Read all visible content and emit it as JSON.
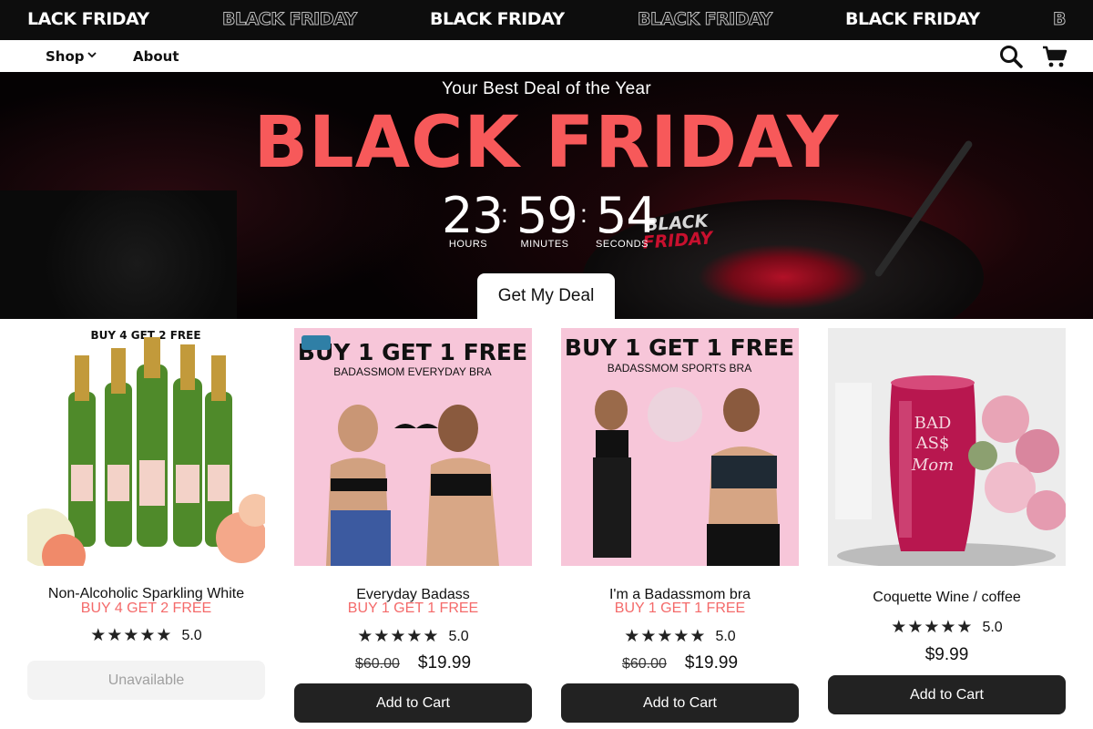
{
  "marquee": {
    "items": [
      "LACK FRIDAY",
      "BLACK FRIDAY",
      "BLACK FRIDAY",
      "BLACK FRIDAY",
      "BLACK FRIDAY",
      "B"
    ]
  },
  "nav": {
    "shop": "Shop",
    "about": "About"
  },
  "hero": {
    "subtitle": "Your Best Deal of the Year",
    "title": "BLACK FRIDAY",
    "countdown": {
      "hours": "23",
      "minutes": "59",
      "seconds": "54",
      "hours_label": "HOURS",
      "minutes_label": "MINUTES",
      "seconds_label": "SECONDS"
    },
    "image_text_1": "BLACK",
    "image_text_2": "FRIDAY",
    "cta": "Get My Deal"
  },
  "products": [
    {
      "image_text": "BUY 4  GET 2 FREE",
      "title": "Non-Alcoholic Sparkling White",
      "promo": "BUY 4 GET 2 FREE",
      "stars": "★★★★★",
      "rating": "5.0",
      "button": "Unavailable"
    },
    {
      "image_text_1": "BUY 1 GET 1 FREE",
      "image_text_2": "BADASSMOM  EVERYDAY BRA",
      "title": "Everyday  Badass",
      "promo": "BUY 1 GET 1 FREE",
      "stars": "★★★★★",
      "rating": "5.0",
      "was_price": "$60.00",
      "price": "$19.99",
      "button": "Add to Cart"
    },
    {
      "image_text_1": "BUY 1 GET 1 FREE",
      "image_text_2": "BADASSMOM  SPORTS BRA",
      "title": "I'm a Badassmom bra",
      "promo": "BUY 1 GET 1 FREE",
      "stars": "★★★★★",
      "rating": "5.0",
      "was_price": "$60.00",
      "price": "$19.99",
      "button": "Add to Cart"
    },
    {
      "image_text_1": "BAD",
      "image_text_2": "AS$",
      "image_text_3": "Mom",
      "title": "Coquette Wine / coffee",
      "stars": "★★★★★",
      "rating": "5.0",
      "price": "$9.99",
      "button": "Add to Cart"
    }
  ],
  "colors": {
    "accent": "#f7595a",
    "promo": "#f46a6a",
    "button_dark": "#222222",
    "badge": "#2f7fa6",
    "pink_bg": "#f7c6d9"
  }
}
